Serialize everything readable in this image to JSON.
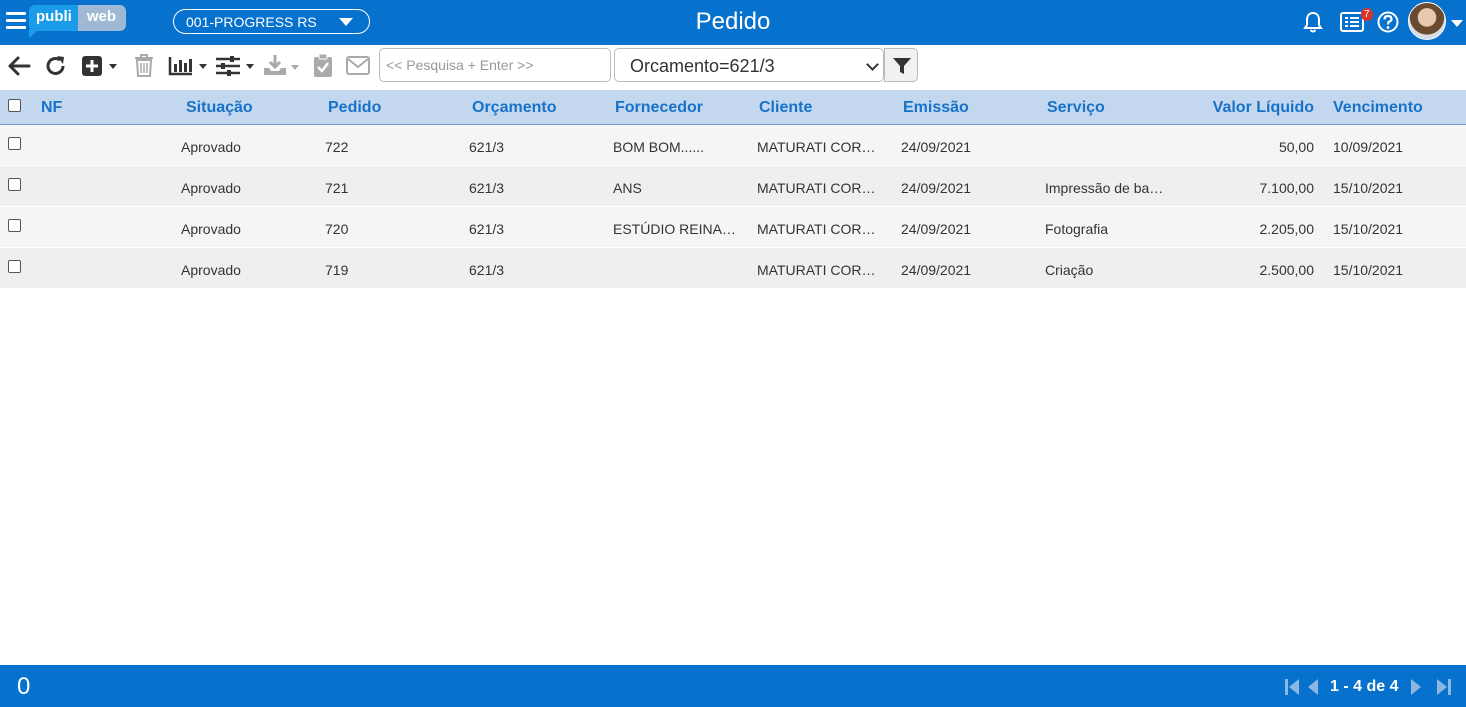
{
  "app": {
    "logo_left": "publi",
    "logo_right": "web",
    "company": "001-PROGRESS RS",
    "page_title": "Pedido",
    "notification_count": "7",
    "icons": [
      "menu-icon",
      "bell-icon",
      "list-icon",
      "help-icon",
      "avatar"
    ]
  },
  "toolbar": {
    "search_placeholder": "<< Pesquisa + Enter >>",
    "filter_value": "Orcamento=621/3",
    "icons": [
      "back-arrow-icon",
      "refresh-icon",
      "add-icon",
      "trash-icon",
      "chart-icon",
      "sliders-icon",
      "download-icon",
      "clipboard-check-icon",
      "envelope-icon",
      "filter-icon"
    ]
  },
  "table": {
    "columns": [
      "NF",
      "Situação",
      "Pedido",
      "Orçamento",
      "Fornecedor",
      "Cliente",
      "Emissão",
      "Serviço",
      "Valor Líquido",
      "Vencimento"
    ],
    "rows": [
      {
        "nf": "",
        "situacao": "Aprovado",
        "pedido": "722",
        "orcamento": "621/3",
        "fornecedor": "BOM BOM......",
        "cliente": "MATURATI COR…",
        "emissao": "24/09/2021",
        "servico": "",
        "valor": "50,00",
        "vencimento": "10/09/2021"
      },
      {
        "nf": "",
        "situacao": "Aprovado",
        "pedido": "721",
        "orcamento": "621/3",
        "fornecedor": "ANS",
        "cliente": "MATURATI COR…",
        "emissao": "24/09/2021",
        "servico": "Impressão de ba…",
        "valor": "7.100,00",
        "vencimento": "15/10/2021"
      },
      {
        "nf": "",
        "situacao": "Aprovado",
        "pedido": "720",
        "orcamento": "621/3",
        "fornecedor": "ESTÚDIO REINA…",
        "cliente": "MATURATI COR…",
        "emissao": "24/09/2021",
        "servico": "Fotografia",
        "valor": "2.205,00",
        "vencimento": "15/10/2021"
      },
      {
        "nf": "",
        "situacao": "Aprovado",
        "pedido": "719",
        "orcamento": "621/3",
        "fornecedor": "",
        "cliente": "MATURATI COR…",
        "emissao": "24/09/2021",
        "servico": "Criação",
        "valor": "2.500,00",
        "vencimento": "15/10/2021"
      }
    ]
  },
  "footer": {
    "selected_count": "0",
    "pager_text": "1 - 4 de 4"
  },
  "colors": {
    "primary": "#0771ce",
    "header_bg": "#c3d8ee",
    "header_text": "#1972c8",
    "badge": "#d9332a"
  }
}
